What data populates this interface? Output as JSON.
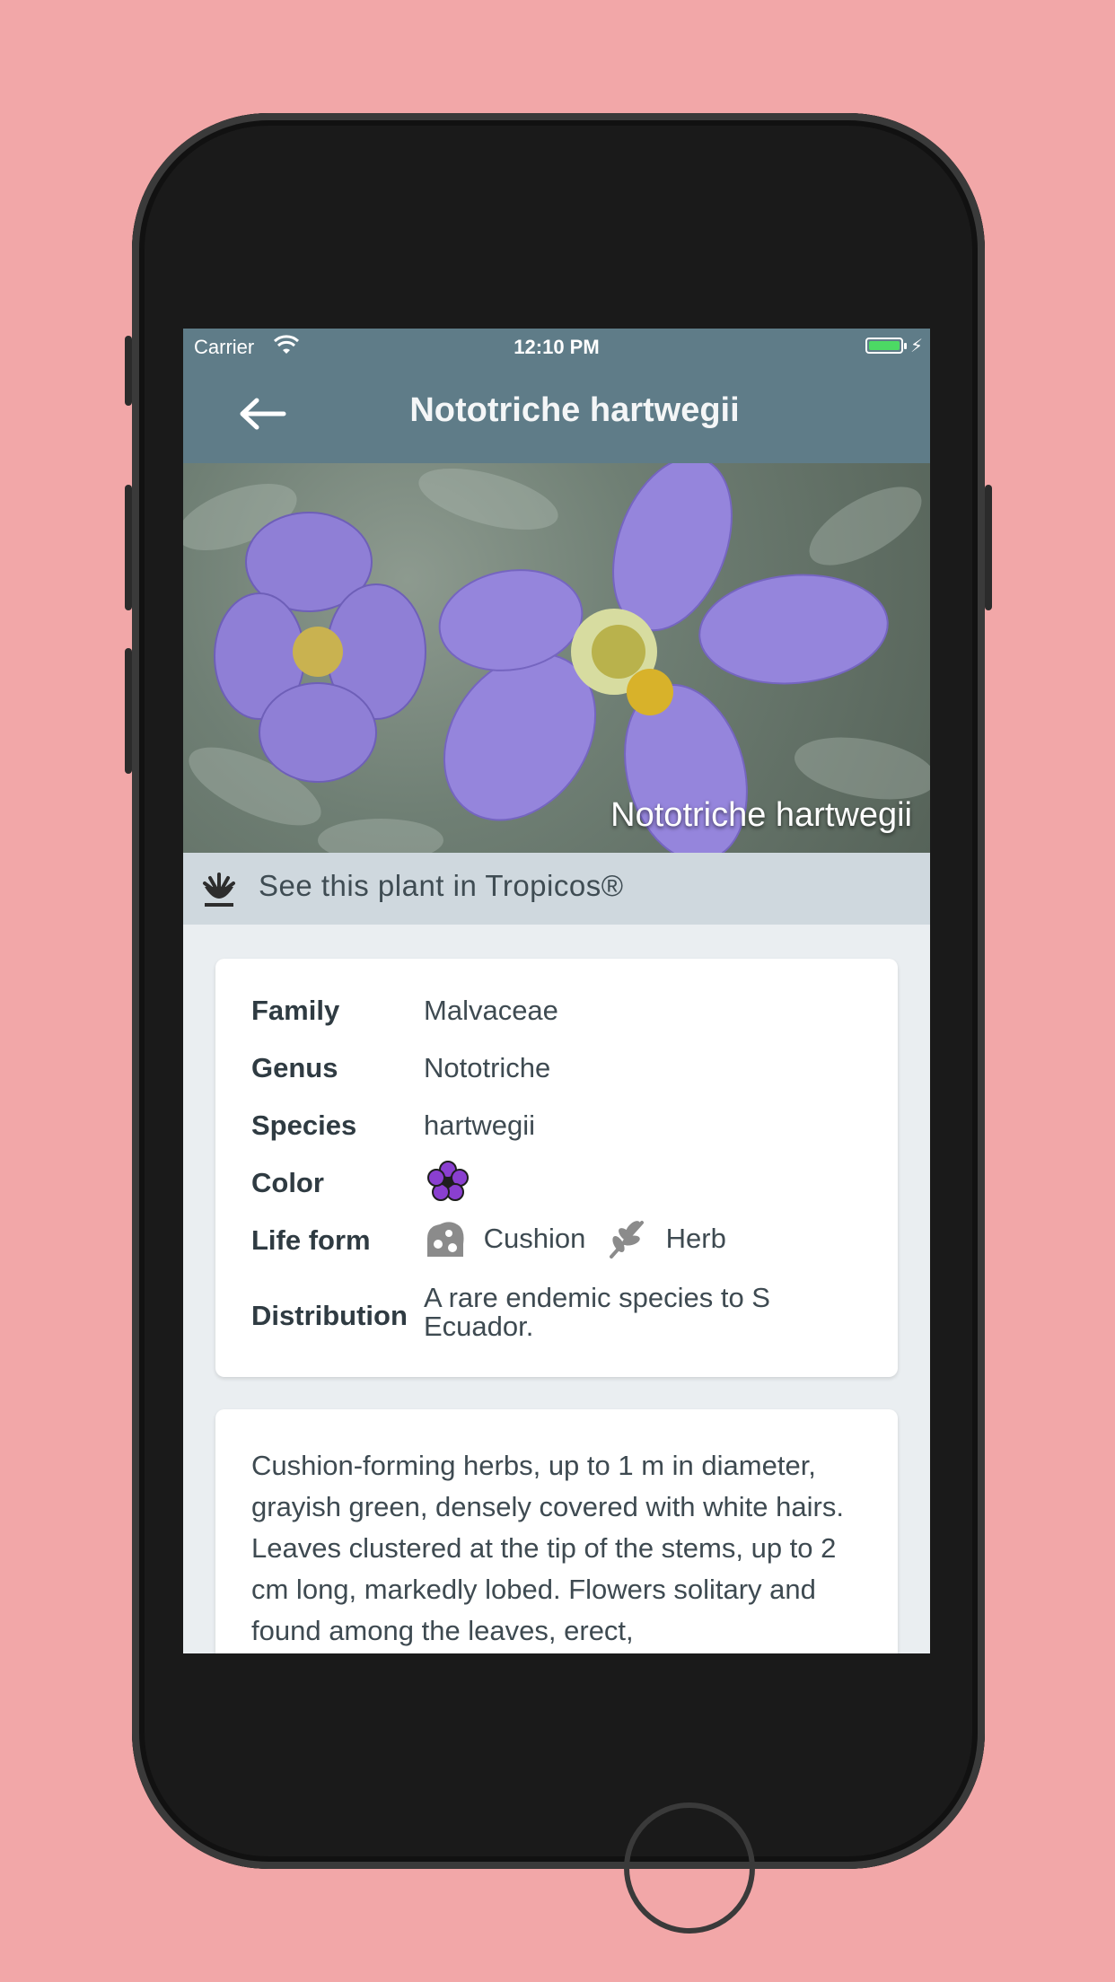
{
  "status": {
    "carrier": "Carrier",
    "time": "12:10 PM"
  },
  "nav": {
    "title": "Nototriche hartwegii",
    "back_icon": "arrow-left-icon"
  },
  "hero": {
    "caption": "Nototriche hartwegii"
  },
  "tropicos": {
    "label": "See this plant in Tropicos®",
    "icon": "tropicos-logo-icon"
  },
  "info": {
    "family_label": "Family",
    "family_value": "Malvaceae",
    "genus_label": "Genus",
    "genus_value": "Nototriche",
    "species_label": "Species",
    "species_value": "hartwegii",
    "color_label": "Color",
    "color_icon": "purple-flower-icon",
    "color_hex": "#8a3fd0",
    "lifeform_label": "Life form",
    "lifeform_1": "Cushion",
    "lifeform_2": "Herb",
    "distribution_label": "Distribution",
    "distribution_value": "A rare endemic species to S Ecuador."
  },
  "description": "Cushion-forming herbs, up to 1 m in diameter, grayish green, densely covered with white hairs. Leaves clustered at the tip of the stems, up to 2 cm long, markedly lobed. Flowers solitary and found among the leaves, erect,",
  "colors": {
    "nav_bg": "#5f7c88",
    "page_bg": "#f2a7a8",
    "tropicos_bg": "#cfd8de"
  }
}
